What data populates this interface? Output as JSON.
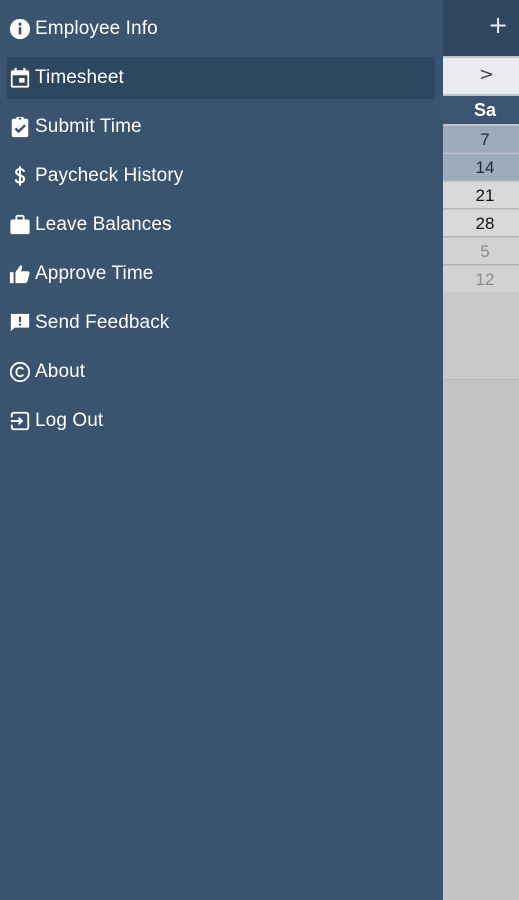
{
  "drawer": {
    "items": [
      {
        "label": "Employee Info",
        "icon": "info-icon",
        "active": false
      },
      {
        "label": "Timesheet",
        "icon": "calendar-icon",
        "active": true
      },
      {
        "label": "Submit Time",
        "icon": "clipboard-check-icon",
        "active": false
      },
      {
        "label": "Paycheck History",
        "icon": "dollar-icon",
        "active": false
      },
      {
        "label": "Leave Balances",
        "icon": "briefcase-icon",
        "active": false
      },
      {
        "label": "Approve Time",
        "icon": "thumbs-up-icon",
        "active": false
      },
      {
        "label": "Send Feedback",
        "icon": "feedback-icon",
        "active": false
      },
      {
        "label": "About",
        "icon": "copyright-icon",
        "active": false
      },
      {
        "label": "Log Out",
        "icon": "logout-icon",
        "active": false
      }
    ]
  },
  "background": {
    "add_label": "+",
    "calendar": {
      "next_label": ">",
      "day_header": "Sa",
      "days": [
        "7",
        "14",
        "21",
        "28",
        "5",
        "12"
      ]
    }
  },
  "colors": {
    "drawer_bg": "#3a546f",
    "active_item_bg": "#2e4760",
    "header_bg": "#2e4660",
    "day_header_bg": "#3a5472"
  }
}
